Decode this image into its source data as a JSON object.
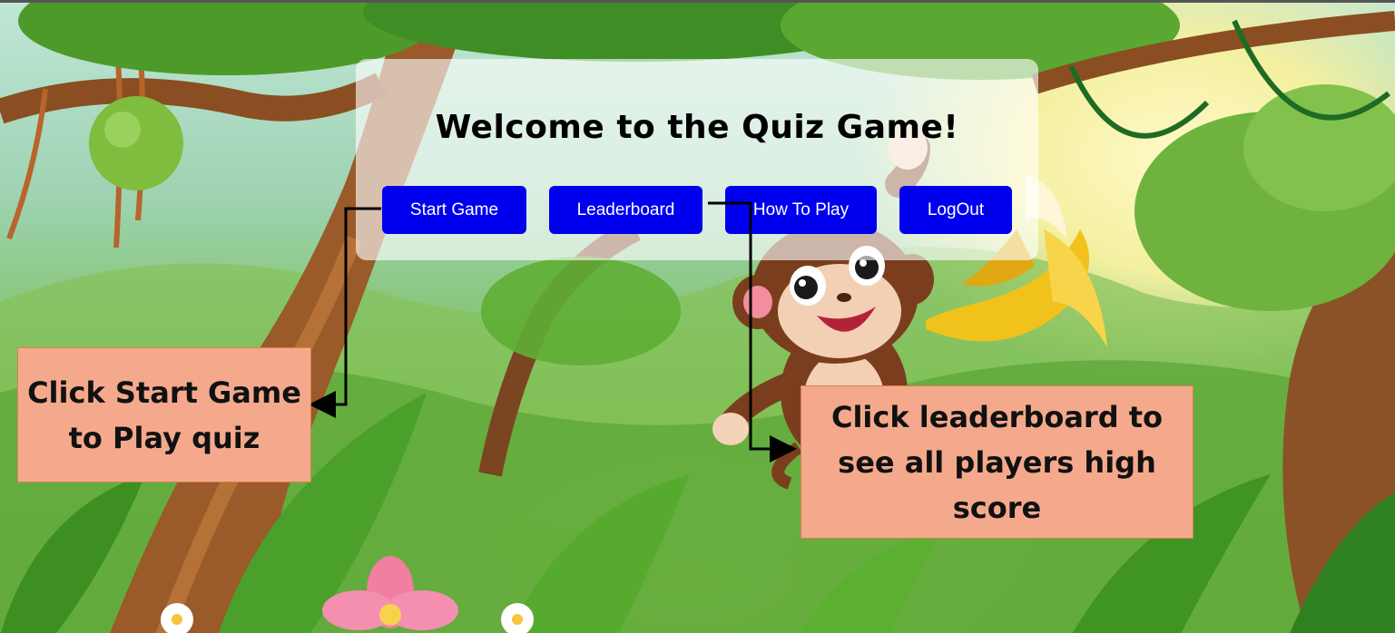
{
  "page": {
    "title": "Welcome to the Quiz Game!"
  },
  "menu": {
    "start_label": "Start Game",
    "leaderboard_label": "Leaderboard",
    "howto_label": "How To Play",
    "logout_label": "LogOut"
  },
  "annotations": {
    "start_callout": "Click Start Game to Play quiz",
    "leaderboard_callout": "Click leaderboard to see all players high score"
  },
  "background": {
    "scene": "jungle-monkey-illustration-icon"
  },
  "colors": {
    "button": "#0000ee",
    "button_text": "#ffffff",
    "callout": "#f4a98c",
    "callout_border": "#d9804f"
  }
}
